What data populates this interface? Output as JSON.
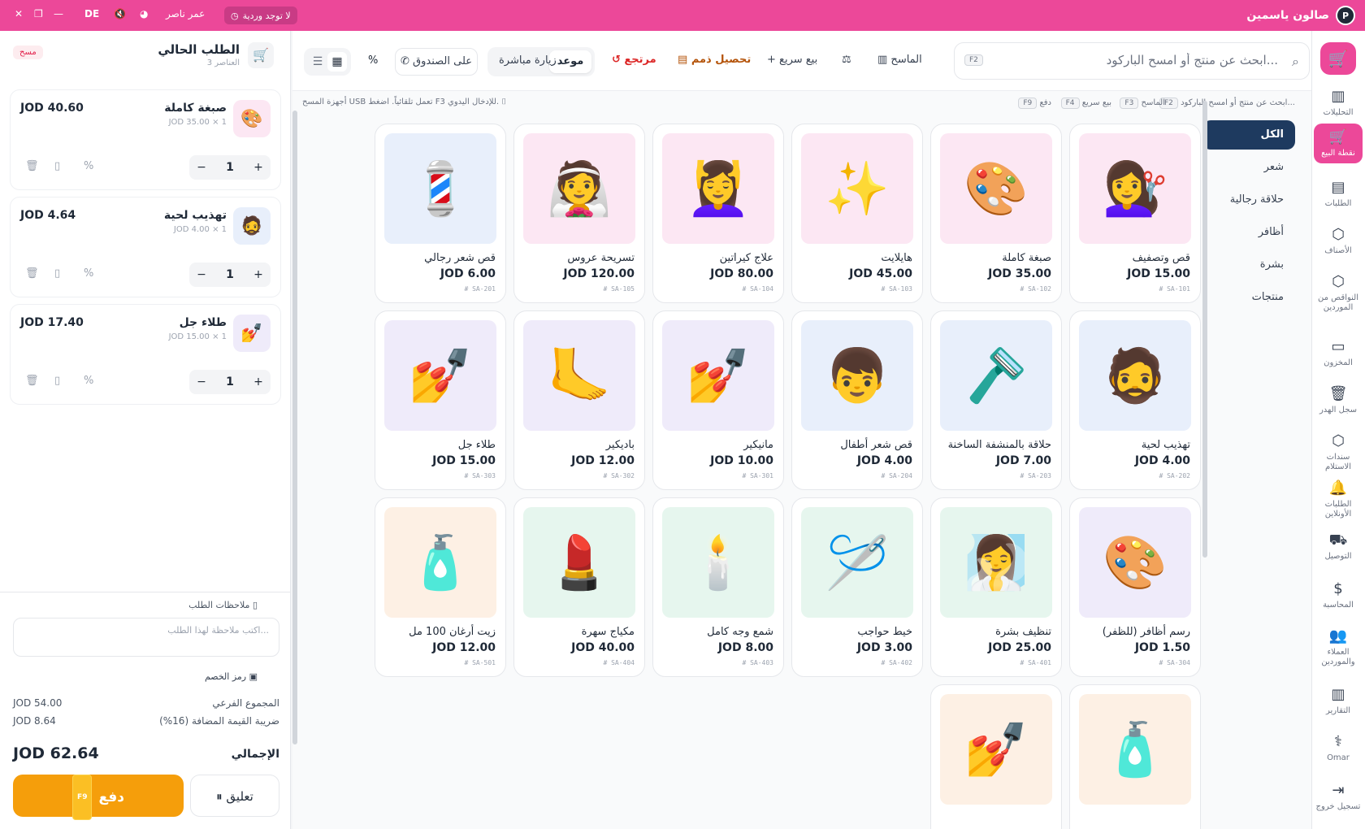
{
  "app": {
    "title": "صالون ياسمين",
    "logo_letter": "P",
    "user": "عمر ناصر",
    "lang": "DE",
    "no_roses": "لا توجد وردية"
  },
  "sidebar": {
    "items": [
      {
        "label": "التحليلات",
        "icon": "▥"
      },
      {
        "label": "نقطة البيع",
        "icon": "🛒"
      },
      {
        "label": "الطلبات",
        "icon": "▤"
      },
      {
        "label": "الأصناف",
        "icon": "⬡"
      },
      {
        "label": "النواقص من الموردين",
        "icon": "⬡"
      },
      {
        "label": "المخزون",
        "icon": "▭"
      },
      {
        "label": "سجل الهدر",
        "icon": "🗑"
      },
      {
        "label": "سندات الاستلام",
        "icon": "⬡"
      },
      {
        "label": "الطلبات الأونلاين",
        "icon": "🔔"
      },
      {
        "label": "التوصيل",
        "icon": "⛟"
      },
      {
        "label": "المحاسبة",
        "icon": "$"
      },
      {
        "label": "العملاء والموردين",
        "icon": "👥"
      },
      {
        "label": "التقارير",
        "icon": "▥"
      },
      {
        "label": "Omar",
        "icon": "⚕"
      },
      {
        "label": "تسجيل خروج",
        "icon": "⇥"
      }
    ]
  },
  "toolbar": {
    "search_placeholder": "ابحث عن منتج أو امسح الباركود...",
    "search_key": "F2",
    "scanner": "الماسح",
    "quick_sale": "بيع سريع",
    "collect_debts": "تحصيل ذمم",
    "returned": "مرتجع",
    "appointment": "موعد",
    "walk_in": "زيارة مباشرة",
    "drawer": "على الصندوق",
    "percent": "%"
  },
  "hints": {
    "h1_key": "F2",
    "h1": "ابحث عن منتج أو امسح الباركود...",
    "h2_key": "F3",
    "h2": "الماسح",
    "h3_key": "F4",
    "h3": "بيع سريع",
    "h4_key": "F9",
    "h4": "دفع",
    "usb": "أجهزة المسح USB تعمل تلقائياً. اضغط F3 للإدخال اليدوي."
  },
  "categories": [
    "الكل",
    "شعر",
    "حلاقة رجالية",
    "أظافر",
    "بشرة",
    "منتجات"
  ],
  "products": [
    {
      "name": "قص وتصفيف",
      "price": "JOD 15.00",
      "sku": "# SA-101",
      "emoji": "💇‍♀️",
      "bg": "#fce7f3"
    },
    {
      "name": "صبغة كاملة",
      "price": "JOD 35.00",
      "sku": "# SA-102",
      "emoji": "🎨",
      "bg": "#fce7f3"
    },
    {
      "name": "هايلايت",
      "price": "JOD 45.00",
      "sku": "# SA-103",
      "emoji": "✨",
      "bg": "#fce7f3"
    },
    {
      "name": "علاج كيراتين",
      "price": "JOD 80.00",
      "sku": "# SA-104",
      "emoji": "💆‍♀️",
      "bg": "#fce7f3"
    },
    {
      "name": "تسريحة عروس",
      "price": "JOD 120.00",
      "sku": "# SA-105",
      "emoji": "👰",
      "bg": "#fce7f3"
    },
    {
      "name": "قص شعر رجالي",
      "price": "JOD 6.00",
      "sku": "# SA-201",
      "emoji": "💈",
      "bg": "#e8effb"
    },
    {
      "name": "تهذيب لحية",
      "price": "JOD 4.00",
      "sku": "# SA-202",
      "emoji": "🧔",
      "bg": "#e8effb"
    },
    {
      "name": "حلاقة بالمنشفة الساخنة",
      "price": "JOD 7.00",
      "sku": "# SA-203",
      "emoji": "🪒",
      "bg": "#e8effb"
    },
    {
      "name": "قص شعر أطفال",
      "price": "JOD 4.00",
      "sku": "# SA-204",
      "emoji": "👦",
      "bg": "#e8effb"
    },
    {
      "name": "مانيكير",
      "price": "JOD 10.00",
      "sku": "# SA-301",
      "emoji": "💅",
      "bg": "#efebfa"
    },
    {
      "name": "باديكير",
      "price": "JOD 12.00",
      "sku": "# SA-302",
      "emoji": "🦶",
      "bg": "#efebfa"
    },
    {
      "name": "طلاء جل",
      "price": "JOD 15.00",
      "sku": "# SA-303",
      "emoji": "💅",
      "bg": "#efebfa"
    },
    {
      "name": "رسم أظافر (للظفر)",
      "price": "JOD 1.50",
      "sku": "# SA-304",
      "emoji": "🎨",
      "bg": "#efebfa"
    },
    {
      "name": "تنظيف بشرة",
      "price": "JOD 25.00",
      "sku": "# SA-401",
      "emoji": "🧖‍♀️",
      "bg": "#e6f6ee"
    },
    {
      "name": "خيط حواجب",
      "price": "JOD 3.00",
      "sku": "# SA-402",
      "emoji": "🪡",
      "bg": "#e6f6ee"
    },
    {
      "name": "شمع وجه كامل",
      "price": "JOD 8.00",
      "sku": "# SA-403",
      "emoji": "🕯️",
      "bg": "#e6f6ee"
    },
    {
      "name": "مكياج سهرة",
      "price": "JOD 40.00",
      "sku": "# SA-404",
      "emoji": "💄",
      "bg": "#e6f6ee"
    },
    {
      "name": "زيت أرغان 100 مل",
      "price": "JOD 12.00",
      "sku": "# SA-501",
      "emoji": "🧴",
      "bg": "#fdf0e4"
    },
    {
      "name": "",
      "price": "",
      "sku": "",
      "emoji": "🧴",
      "bg": "#fdf0e4"
    },
    {
      "name": "",
      "price": "",
      "sku": "",
      "emoji": "💅",
      "bg": "#fdf0e4"
    }
  ],
  "order": {
    "title": "الطلب الحالي",
    "count": "3 العناصر",
    "clear": "مسح",
    "items": [
      {
        "name": "صبغة كاملة",
        "qty_price": "JOD 35.00 × 1",
        "total": "JOD 40.60",
        "qty": "1",
        "emoji": "🎨",
        "bg": "#fce7f3"
      },
      {
        "name": "تهذيب لحية",
        "qty_price": "JOD 4.00 × 1",
        "total": "JOD 4.64",
        "qty": "1",
        "emoji": "🧔",
        "bg": "#e8effb"
      },
      {
        "name": "طلاء جل",
        "qty_price": "JOD 15.00 × 1",
        "total": "JOD 17.40",
        "qty": "1",
        "emoji": "💅",
        "bg": "#efebfa"
      }
    ],
    "notes_label": "ملاحظات الطلب",
    "notes_placeholder": "اكتب ملاحظة لهذا الطلب...",
    "discount_label": "رمز الخصم",
    "subtotal_label": "المجموع الفرعي",
    "subtotal": "JOD 54.00",
    "vat_label": "ضريبة القيمة المضافة (16%)",
    "vat": "JOD 8.64",
    "total_label": "الإجمالي",
    "total": "JOD 62.64",
    "pay": "دفع",
    "pay_key": "F9",
    "hold": "تعليق"
  },
  "colors": {
    "brand": "#ec4899",
    "pay": "#f59e0b",
    "active_cat": "#1e3a5f"
  }
}
